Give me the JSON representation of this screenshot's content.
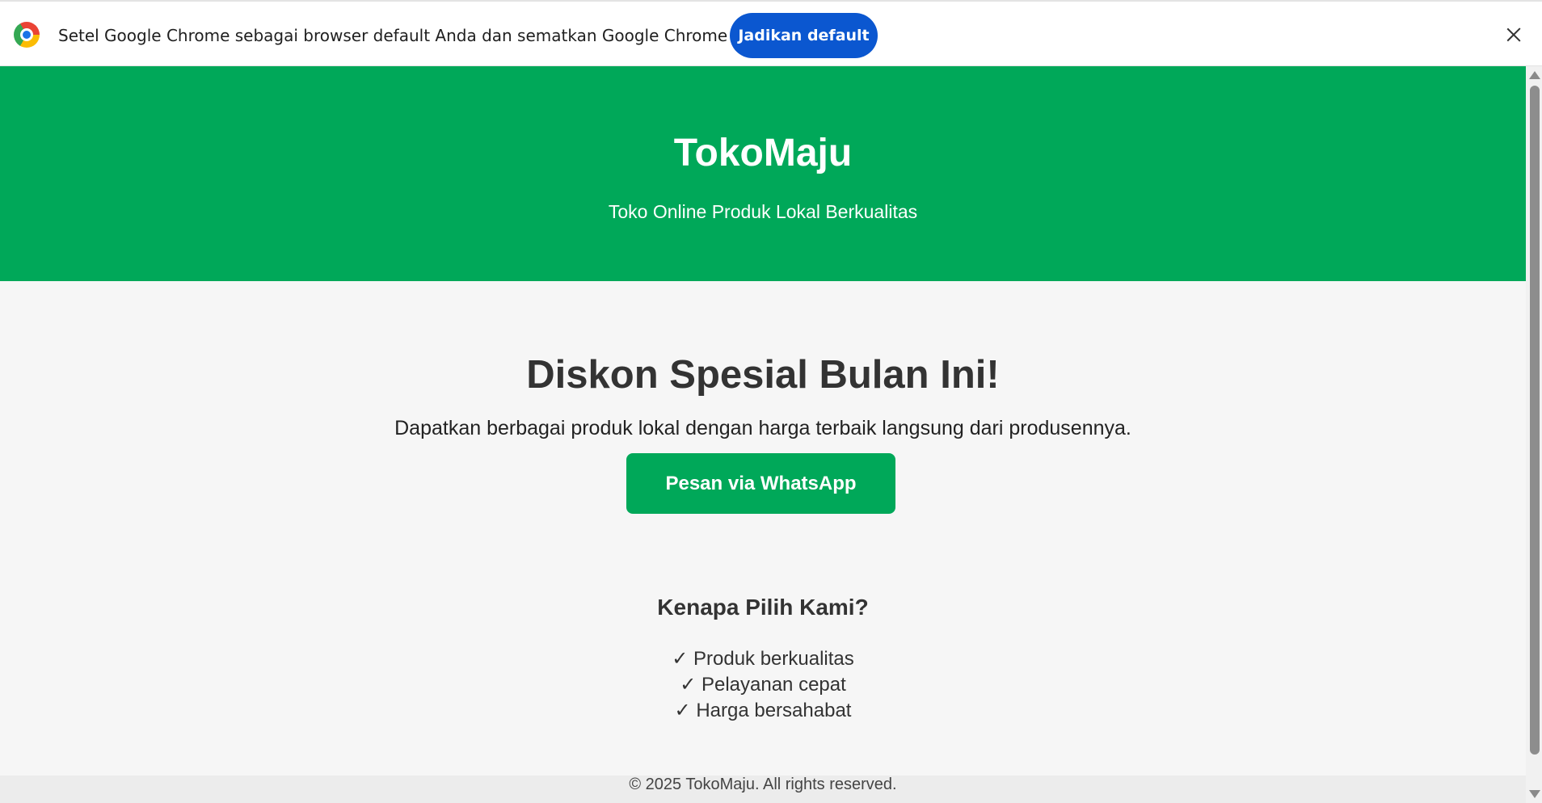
{
  "infobar": {
    "message": "Setel Google Chrome sebagai browser default Anda dan sematkan Google Chrome ke taskbar",
    "button_label": "Jadikan default",
    "button_color": "#0b57d0",
    "icons": [
      "chrome-logo-icon",
      "close-icon"
    ]
  },
  "header": {
    "title": "TokoMaju",
    "tagline": "Toko Online Produk Lokal Berkualitas",
    "background_color": "#00a859"
  },
  "promo": {
    "title": "Diskon Spesial Bulan Ini!",
    "text": "Dapatkan berbagai produk lokal dengan harga terbaik langsung dari produsennya.",
    "button_label": "Pesan via WhatsApp"
  },
  "why": {
    "title": "Kenapa Pilih Kami?",
    "items": [
      "✓ Produk berkualitas",
      "✓ Pelayanan cepat",
      "✓ Harga bersahabat"
    ]
  },
  "footer": {
    "text": "© 2025 TokoMaju. All rights reserved."
  }
}
